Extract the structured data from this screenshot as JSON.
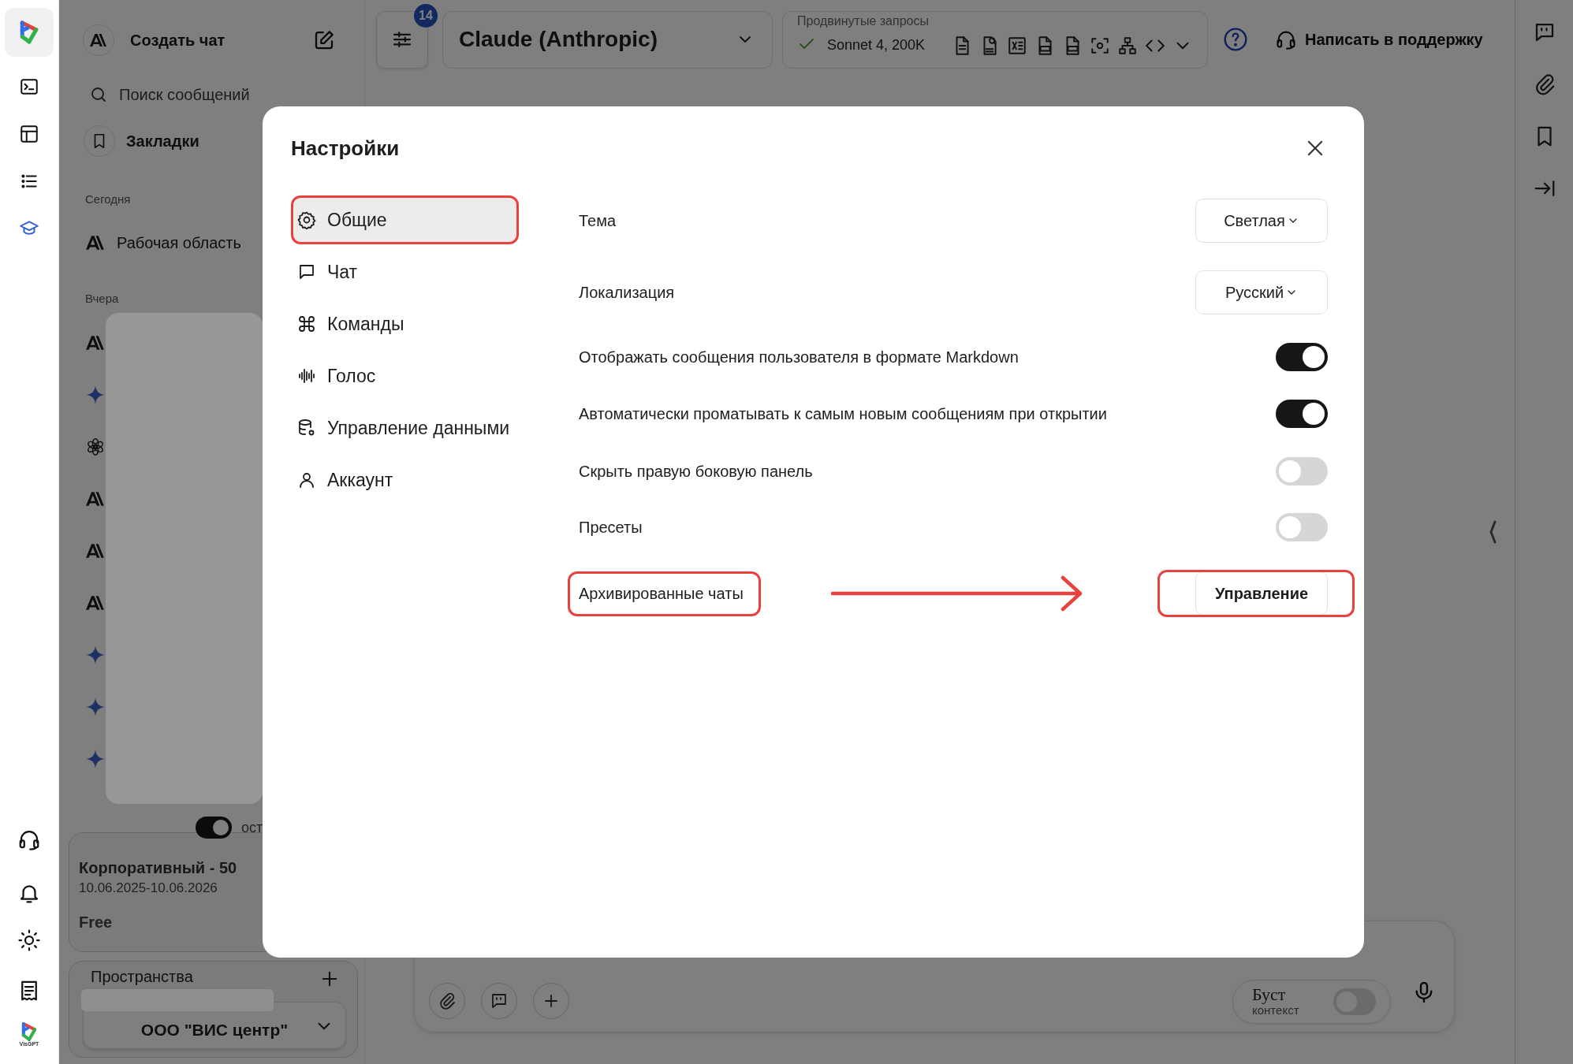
{
  "rail": {
    "logo_caption": "VisGPT"
  },
  "sidebar": {
    "new_chat": "Создать чат",
    "search": {
      "placeholder": "Поиск сообщений"
    },
    "bookmarks": "Закладки",
    "sections": [
      {
        "title": "Сегодня",
        "items": [
          {
            "label": "Рабочая область"
          }
        ]
      },
      {
        "title": "Вчера"
      }
    ],
    "plan_toggle": {
      "on": true,
      "label": "ост"
    },
    "plan": {
      "name": "Корпоративный - 50",
      "period": "10.06.2025-10.06.2026",
      "tier": "Free"
    },
    "spaces": {
      "title": "Пространства",
      "selected": "ООО \"ВИС центр\""
    }
  },
  "topbar": {
    "filters_badge": "14",
    "model": "Claude (Anthropic)",
    "advanced": {
      "title": "Продвинутые запросы",
      "model": "Sonnet 4, 200K"
    },
    "support": "Написать в поддержку"
  },
  "composer": {
    "boost": {
      "label": "Буст",
      "sublabel": "контекст",
      "on": false
    }
  },
  "settings": {
    "title": "Настройки",
    "nav": [
      {
        "label": "Общие",
        "selected": true,
        "annotated": true
      },
      {
        "label": "Чат",
        "selected": false,
        "annotated": false
      },
      {
        "label": "Команды",
        "selected": false,
        "annotated": false
      },
      {
        "label": "Голос",
        "selected": false,
        "annotated": false
      },
      {
        "label": "Управление данными",
        "selected": false,
        "annotated": false
      },
      {
        "label": "Аккаунт",
        "selected": false,
        "annotated": false
      }
    ],
    "rows": [
      {
        "kind": "select",
        "label": "Тема",
        "value": "Светлая"
      },
      {
        "kind": "select",
        "label": "Локализация",
        "value": "Русский"
      },
      {
        "kind": "toggle",
        "label": "Отображать сообщения пользователя в формате Markdown",
        "on": true
      },
      {
        "kind": "toggle",
        "label": "Автоматически проматывать к самым новым сообщениям при открытии",
        "on": true
      },
      {
        "kind": "toggle",
        "label": "Скрыть правую боковую панель",
        "on": false
      },
      {
        "kind": "toggle",
        "label": "Пресеты",
        "on": false
      },
      {
        "kind": "button",
        "label": "Архивированные чаты",
        "button": "Управление",
        "annotated": true
      }
    ]
  }
}
